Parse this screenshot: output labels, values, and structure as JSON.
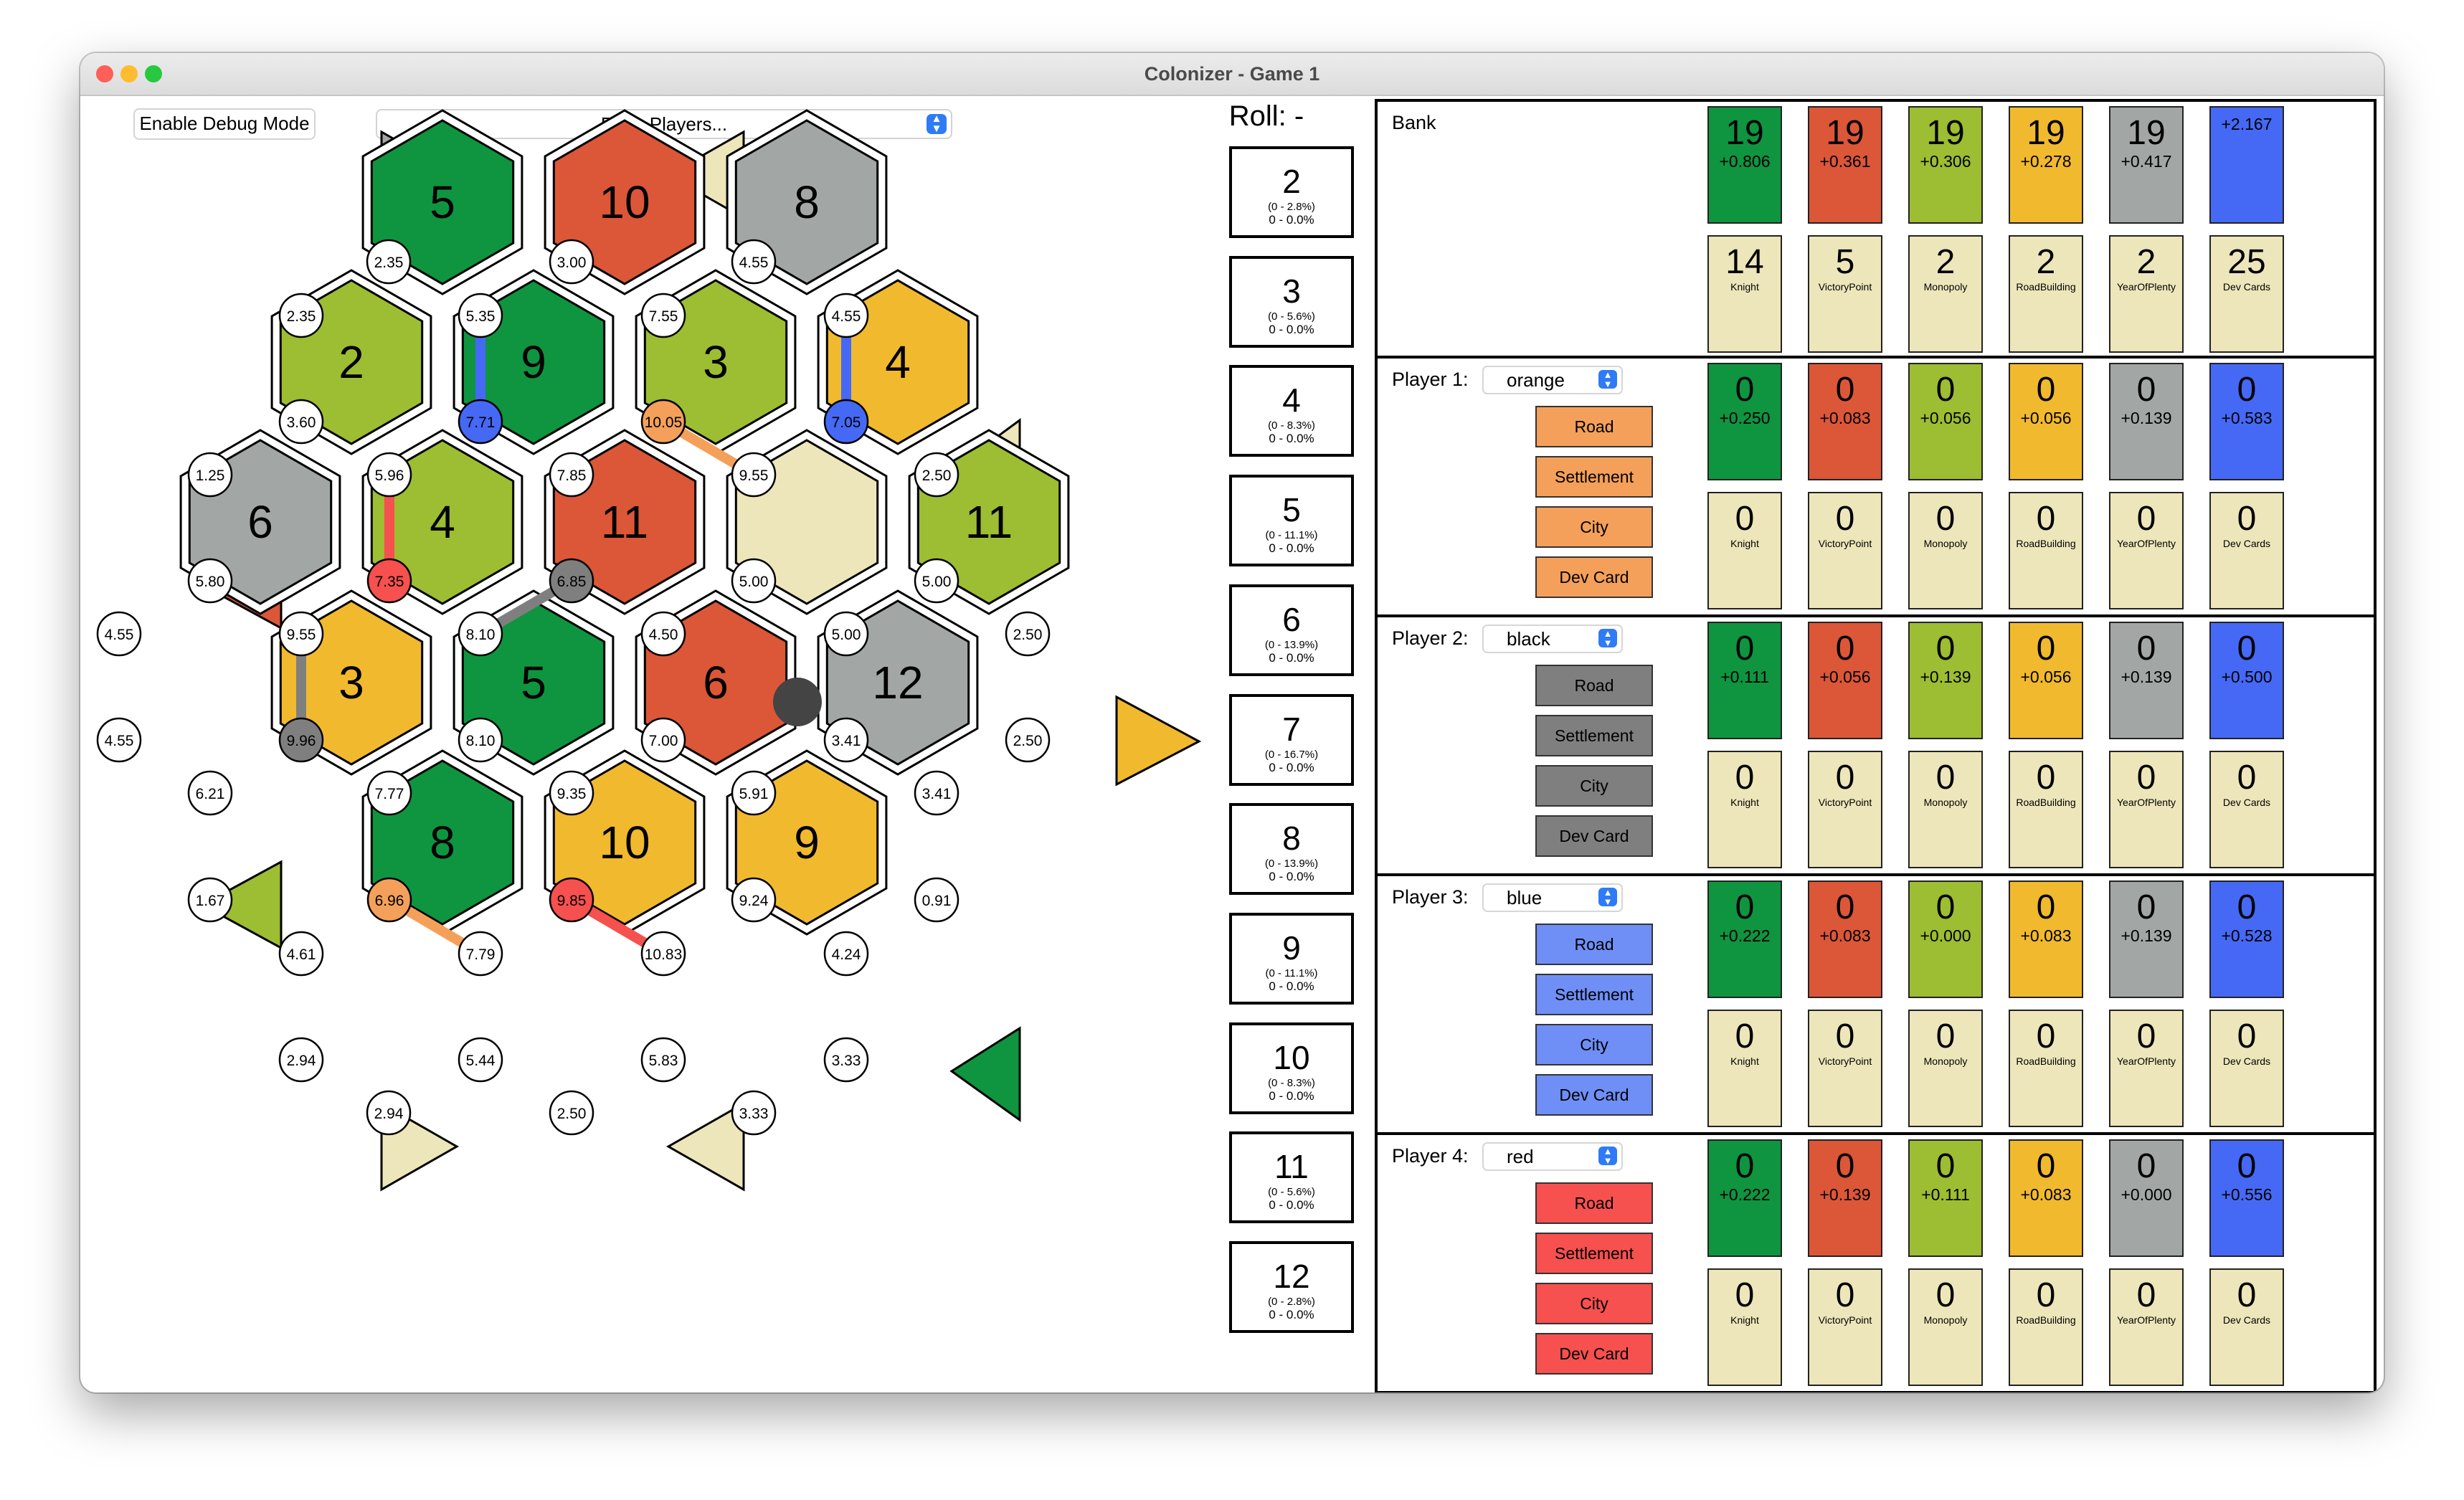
{
  "window": {
    "title": "Colonizer - Game 1"
  },
  "toolbar": {
    "debug_button": "Enable Debug Mode",
    "rank_select": "Rank Players..."
  },
  "colors": {
    "wood": "#0f9440",
    "brick": "#dc5638",
    "sheep": "#9dbd32",
    "wheat": "#f1b92e",
    "ore": "#a2a7a5",
    "desert": "#ede6ba",
    "blue": "#4569f5",
    "card": "#ede6ba",
    "orange": "#f4a05a",
    "black": "#7f7f7f",
    "bluebtn": "#6f8ff7",
    "red": "#f6504f"
  },
  "board": {
    "hexes": [
      {
        "res": "wood",
        "num": "5"
      },
      {
        "res": "brick",
        "num": "10"
      },
      {
        "res": "ore",
        "num": "8"
      },
      {
        "res": "sheep",
        "num": "2"
      },
      {
        "res": "wood",
        "num": "9"
      },
      {
        "res": "sheep",
        "num": "3"
      },
      {
        "res": "wheat",
        "num": "4"
      },
      {
        "res": "ore",
        "num": "6"
      },
      {
        "res": "sheep",
        "num": "4"
      },
      {
        "res": "brick",
        "num": "11"
      },
      {
        "res": "desert",
        "num": ""
      },
      {
        "res": "sheep",
        "num": "11"
      },
      {
        "res": "wheat",
        "num": "3"
      },
      {
        "res": "wood",
        "num": "5"
      },
      {
        "res": "brick",
        "num": "6"
      },
      {
        "res": "ore",
        "num": "12"
      },
      {
        "res": "wood",
        "num": "8"
      },
      {
        "res": "wheat",
        "num": "10"
      },
      {
        "res": "wheat",
        "num": "9"
      }
    ],
    "vertices": [
      {
        "label": "2.35",
        "owner": ""
      },
      {
        "label": "3.00",
        "owner": ""
      },
      {
        "label": "4.55",
        "owner": ""
      },
      {
        "label": "2.35",
        "owner": ""
      },
      {
        "label": "5.35",
        "owner": ""
      },
      {
        "label": "7.55",
        "owner": ""
      },
      {
        "label": "4.55",
        "owner": ""
      },
      {
        "label": "3.60",
        "owner": ""
      },
      {
        "label": "7.71",
        "owner": "blue"
      },
      {
        "label": "10.05",
        "owner": "orange"
      },
      {
        "label": "7.05",
        "owner": "blue"
      },
      {
        "label": "1.25",
        "owner": ""
      },
      {
        "label": "5.96",
        "owner": ""
      },
      {
        "label": "7.85",
        "owner": ""
      },
      {
        "label": "9.55",
        "owner": ""
      },
      {
        "label": "2.50",
        "owner": ""
      },
      {
        "label": "5.80",
        "owner": ""
      },
      {
        "label": "7.35",
        "owner": "red"
      },
      {
        "label": "6.85",
        "owner": "black"
      },
      {
        "label": "5.00",
        "owner": ""
      },
      {
        "label": "5.00",
        "owner": ""
      },
      {
        "label": "4.55",
        "owner": ""
      },
      {
        "label": "9.55",
        "owner": ""
      },
      {
        "label": "8.10",
        "owner": ""
      },
      {
        "label": "4.50",
        "owner": ""
      },
      {
        "label": "5.00",
        "owner": ""
      },
      {
        "label": "2.50",
        "owner": ""
      },
      {
        "label": "4.55",
        "owner": ""
      },
      {
        "label": "9.96",
        "owner": "black"
      },
      {
        "label": "8.10",
        "owner": ""
      },
      {
        "label": "7.00",
        "owner": ""
      },
      {
        "label": "3.41",
        "owner": ""
      },
      {
        "label": "2.50",
        "owner": ""
      },
      {
        "label": "6.21",
        "owner": ""
      },
      {
        "label": "7.77",
        "owner": ""
      },
      {
        "label": "9.35",
        "owner": ""
      },
      {
        "label": "5.91",
        "owner": ""
      },
      {
        "label": "3.41",
        "owner": ""
      },
      {
        "label": "1.67",
        "owner": ""
      },
      {
        "label": "6.96",
        "owner": "orange"
      },
      {
        "label": "9.85",
        "owner": "red"
      },
      {
        "label": "9.24",
        "owner": ""
      },
      {
        "label": "0.91",
        "owner": ""
      },
      {
        "label": "4.61",
        "owner": ""
      },
      {
        "label": "7.79",
        "owner": ""
      },
      {
        "label": "10.83",
        "owner": ""
      },
      {
        "label": "4.24",
        "owner": ""
      },
      {
        "label": "2.94",
        "owner": ""
      },
      {
        "label": "5.44",
        "owner": ""
      },
      {
        "label": "5.83",
        "owner": ""
      },
      {
        "label": "3.33",
        "owner": ""
      },
      {
        "label": "2.94",
        "owner": ""
      },
      {
        "label": "2.50",
        "owner": ""
      },
      {
        "label": "3.33",
        "owner": ""
      }
    ]
  },
  "roll": {
    "title": "Roll: -",
    "items": [
      {
        "num": "2",
        "prob": "(0 - 2.8%)",
        "count": "0 - 0.0%"
      },
      {
        "num": "3",
        "prob": "(0 - 5.6%)",
        "count": "0 - 0.0%"
      },
      {
        "num": "4",
        "prob": "(0 - 8.3%)",
        "count": "0 - 0.0%"
      },
      {
        "num": "5",
        "prob": "(0 - 11.1%)",
        "count": "0 - 0.0%"
      },
      {
        "num": "6",
        "prob": "(0 - 13.9%)",
        "count": "0 - 0.0%"
      },
      {
        "num": "7",
        "prob": "(0 - 16.7%)",
        "count": "0 - 0.0%"
      },
      {
        "num": "8",
        "prob": "(0 - 13.9%)",
        "count": "0 - 0.0%"
      },
      {
        "num": "9",
        "prob": "(0 - 11.1%)",
        "count": "0 - 0.0%"
      },
      {
        "num": "10",
        "prob": "(0 - 8.3%)",
        "count": "0 - 0.0%"
      },
      {
        "num": "11",
        "prob": "(0 - 5.6%)",
        "count": "0 - 0.0%"
      },
      {
        "num": "12",
        "prob": "(0 - 2.8%)",
        "count": "0 - 0.0%"
      }
    ]
  },
  "bank": {
    "title": "Bank",
    "resources": [
      {
        "count": "19",
        "rate": "+0.806"
      },
      {
        "count": "19",
        "rate": "+0.361"
      },
      {
        "count": "19",
        "rate": "+0.306"
      },
      {
        "count": "19",
        "rate": "+0.278"
      },
      {
        "count": "19",
        "rate": "+0.417"
      },
      {
        "count": "",
        "rate": "+2.167"
      }
    ],
    "dev": [
      {
        "count": "14",
        "label": "Knight"
      },
      {
        "count": "5",
        "label": "VictoryPoint"
      },
      {
        "count": "2",
        "label": "Monopoly"
      },
      {
        "count": "2",
        "label": "RoadBuilding"
      },
      {
        "count": "2",
        "label": "YearOfPlenty"
      },
      {
        "count": "25",
        "label": "Dev Cards"
      }
    ]
  },
  "players": [
    {
      "title": "Player 1:",
      "color": "orange",
      "btn_color": "orange",
      "buttons": [
        "Road",
        "Settlement",
        "City",
        "Dev Card"
      ],
      "resources": [
        {
          "count": "0",
          "rate": "+0.250"
        },
        {
          "count": "0",
          "rate": "+0.083"
        },
        {
          "count": "0",
          "rate": "+0.056"
        },
        {
          "count": "0",
          "rate": "+0.056"
        },
        {
          "count": "0",
          "rate": "+0.139"
        },
        {
          "count": "0",
          "rate": "+0.583"
        }
      ],
      "dev": [
        {
          "count": "0",
          "label": "Knight"
        },
        {
          "count": "0",
          "label": "VictoryPoint"
        },
        {
          "count": "0",
          "label": "Monopoly"
        },
        {
          "count": "0",
          "label": "RoadBuilding"
        },
        {
          "count": "0",
          "label": "YearOfPlenty"
        },
        {
          "count": "0",
          "label": "Dev Cards"
        }
      ]
    },
    {
      "title": "Player 2:",
      "color": "black",
      "btn_color": "black",
      "buttons": [
        "Road",
        "Settlement",
        "City",
        "Dev Card"
      ],
      "resources": [
        {
          "count": "0",
          "rate": "+0.111"
        },
        {
          "count": "0",
          "rate": "+0.056"
        },
        {
          "count": "0",
          "rate": "+0.139"
        },
        {
          "count": "0",
          "rate": "+0.056"
        },
        {
          "count": "0",
          "rate": "+0.139"
        },
        {
          "count": "0",
          "rate": "+0.500"
        }
      ],
      "dev": [
        {
          "count": "0",
          "label": "Knight"
        },
        {
          "count": "0",
          "label": "VictoryPoint"
        },
        {
          "count": "0",
          "label": "Monopoly"
        },
        {
          "count": "0",
          "label": "RoadBuilding"
        },
        {
          "count": "0",
          "label": "YearOfPlenty"
        },
        {
          "count": "0",
          "label": "Dev Cards"
        }
      ]
    },
    {
      "title": "Player 3:",
      "color": "blue",
      "btn_color": "bluebtn",
      "buttons": [
        "Road",
        "Settlement",
        "City",
        "Dev Card"
      ],
      "resources": [
        {
          "count": "0",
          "rate": "+0.222"
        },
        {
          "count": "0",
          "rate": "+0.083"
        },
        {
          "count": "0",
          "rate": "+0.000"
        },
        {
          "count": "0",
          "rate": "+0.083"
        },
        {
          "count": "0",
          "rate": "+0.139"
        },
        {
          "count": "0",
          "rate": "+0.528"
        }
      ],
      "dev": [
        {
          "count": "0",
          "label": "Knight"
        },
        {
          "count": "0",
          "label": "VictoryPoint"
        },
        {
          "count": "0",
          "label": "Monopoly"
        },
        {
          "count": "0",
          "label": "RoadBuilding"
        },
        {
          "count": "0",
          "label": "YearOfPlenty"
        },
        {
          "count": "0",
          "label": "Dev Cards"
        }
      ]
    },
    {
      "title": "Player 4:",
      "color": "red",
      "btn_color": "red",
      "buttons": [
        "Road",
        "Settlement",
        "City",
        "Dev Card"
      ],
      "resources": [
        {
          "count": "0",
          "rate": "+0.222"
        },
        {
          "count": "0",
          "rate": "+0.139"
        },
        {
          "count": "0",
          "rate": "+0.111"
        },
        {
          "count": "0",
          "rate": "+0.083"
        },
        {
          "count": "0",
          "rate": "+0.000"
        },
        {
          "count": "0",
          "rate": "+0.556"
        }
      ],
      "dev": [
        {
          "count": "0",
          "label": "Knight"
        },
        {
          "count": "0",
          "label": "VictoryPoint"
        },
        {
          "count": "0",
          "label": "Monopoly"
        },
        {
          "count": "0",
          "label": "RoadBuilding"
        },
        {
          "count": "0",
          "label": "YearOfPlenty"
        },
        {
          "count": "0",
          "label": "Dev Cards"
        }
      ]
    }
  ]
}
